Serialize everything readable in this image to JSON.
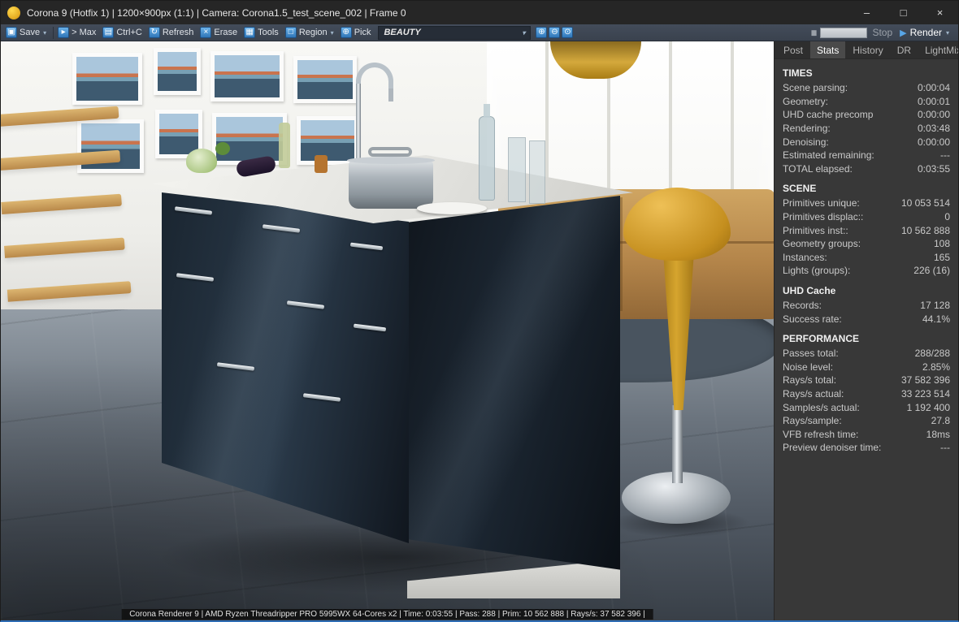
{
  "window": {
    "title": "Corona 9 (Hotfix 1) | 1200×900px (1:1) | Camera: Corona1.5_test_scene_002 | Frame 0",
    "controls": {
      "minimize": "–",
      "maximize": "□",
      "close": "×"
    }
  },
  "icons": {
    "save": "▣",
    "max_nav": "▸",
    "copy": "▤",
    "refresh": "↻",
    "erase": "×",
    "tools": "▦",
    "region": "□",
    "pick": "⊕",
    "zoom_in": "⊕",
    "zoom_out": "⊖",
    "zoom_fit": "⊙",
    "caret": "▾",
    "play": "▶",
    "pause": "▮▮"
  },
  "colors": {
    "toolbar_icon_blue": "#2f76b8",
    "accent_blue": "#58a6e8",
    "stool_yellow": "#d19a2f"
  },
  "toolbar": {
    "save": "Save",
    "max": "> Max",
    "copy": "Ctrl+C",
    "refresh": "Refresh",
    "erase": "Erase",
    "tools": "Tools",
    "region": "Region",
    "pick": "Pick",
    "channel": "BEAUTY",
    "stop": "Stop",
    "render": "Render"
  },
  "tabs": {
    "post": "Post",
    "stats": "Stats",
    "history": "History",
    "dr": "DR",
    "lightmix": "LightMix"
  },
  "stats": {
    "times_title": "TIMES",
    "times_rows": [
      {
        "label": "Scene parsing:",
        "value": "0:00:04"
      },
      {
        "label": "Geometry:",
        "value": "0:00:01"
      },
      {
        "label": "UHD cache precomp",
        "value": "0:00:00"
      },
      {
        "label": "Rendering:",
        "value": "0:03:48"
      },
      {
        "label": "Denoising:",
        "value": "0:00:00"
      },
      {
        "label": "Estimated remaining:",
        "value": "---"
      },
      {
        "label": "TOTAL elapsed:",
        "value": "0:03:55"
      }
    ],
    "scene_title": "SCENE",
    "scene_rows": [
      {
        "label": "Primitives unique:",
        "value": "10 053 514"
      },
      {
        "label": "Primitives displac::",
        "value": "0"
      },
      {
        "label": "Primitives inst::",
        "value": "10 562 888"
      },
      {
        "label": "Geometry groups:",
        "value": "108"
      },
      {
        "label": "Instances:",
        "value": "165"
      },
      {
        "label": "Lights (groups):",
        "value": "226 (16)"
      }
    ],
    "uhd_title": "UHD Cache",
    "uhd_rows": [
      {
        "label": "Records:",
        "value": "17 128"
      },
      {
        "label": "Success rate:",
        "value": "44.1%"
      }
    ],
    "perf_title": "PERFORMANCE",
    "perf_rows": [
      {
        "label": "Passes total:",
        "value": "288/288"
      },
      {
        "label": "Noise level:",
        "value": "2.85%"
      },
      {
        "label": "Rays/s total:",
        "value": "37 582 396"
      },
      {
        "label": "Rays/s actual:",
        "value": "33 223 514"
      },
      {
        "label": "Samples/s actual:",
        "value": "1 192 400"
      },
      {
        "label": "Rays/sample:",
        "value": "27.8"
      },
      {
        "label": "VFB refresh time:",
        "value": "18ms"
      },
      {
        "label": "Preview denoiser time:",
        "value": "---"
      }
    ]
  },
  "statusbar": {
    "text": "Corona Renderer 9 | AMD Ryzen Threadripper PRO 5995WX 64-Cores  x2 | Time: 0:03:55 | Pass: 288 | Prim: 10 562 888 | Rays/s: 37 582 396 |"
  }
}
